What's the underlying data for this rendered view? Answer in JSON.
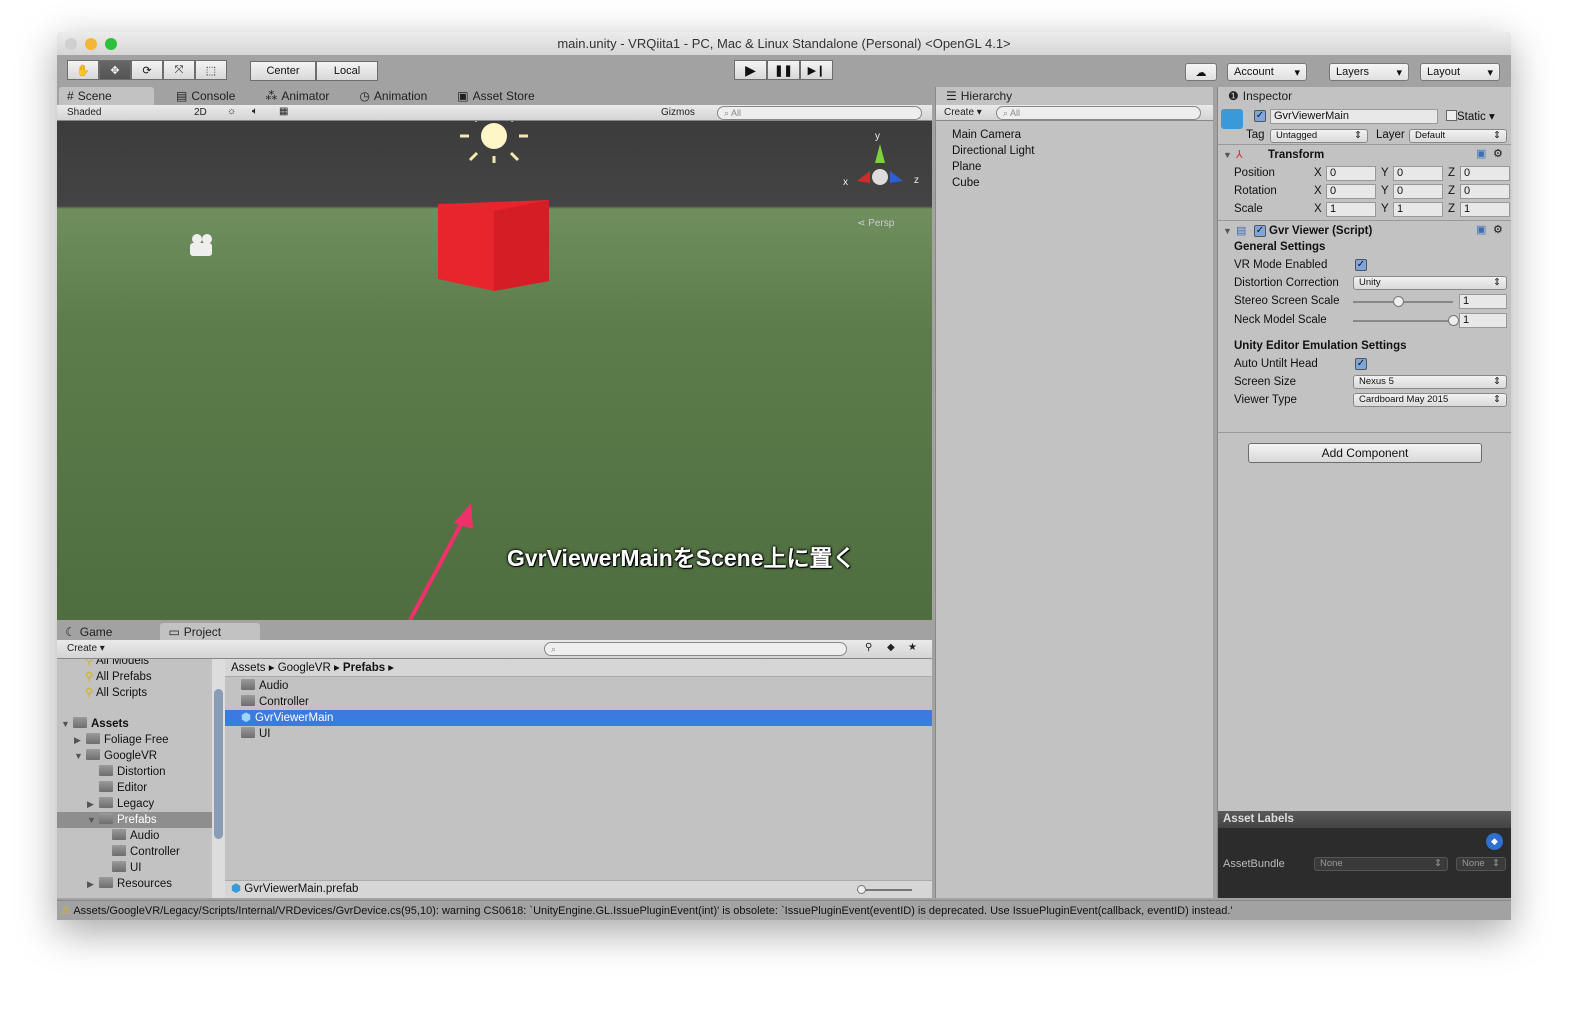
{
  "window": {
    "title": "main.unity - VRQiita1 - PC, Mac & Linux Standalone (Personal) <OpenGL 4.1>"
  },
  "toolbar": {
    "pivot": "Center",
    "space": "Local",
    "account": "Account",
    "layers": "Layers",
    "layout": "Layout"
  },
  "scene_tabs": [
    "Scene",
    "Console",
    "Animator",
    "Animation",
    "Asset Store"
  ],
  "scene_toolbar": {
    "shading": "Shaded",
    "mode2d": "2D",
    "gizmos": "Gizmos",
    "search_placeholder": "All"
  },
  "scene": {
    "gizmo_y": "y",
    "gizmo_x": "x",
    "gizmo_z": "z",
    "persp": "Persp",
    "annotation": "GvrViewerMainをScene上に置く"
  },
  "hierarchy": {
    "tab": "Hierarchy",
    "create": "Create",
    "search_placeholder": "All",
    "items": [
      "Main Camera",
      "Directional Light",
      "Plane",
      "Cube"
    ]
  },
  "inspector": {
    "tab": "Inspector",
    "object_name": "GvrViewerMain",
    "static_label": "Static",
    "tag_label": "Tag",
    "tag": "Untagged",
    "layer_label": "Layer",
    "layer": "Default",
    "transform": {
      "title": "Transform",
      "rows": [
        {
          "label": "Position",
          "x": "0",
          "y": "0",
          "z": "0"
        },
        {
          "label": "Rotation",
          "x": "0",
          "y": "0",
          "z": "0"
        },
        {
          "label": "Scale",
          "x": "1",
          "y": "1",
          "z": "1"
        }
      ]
    },
    "script": {
      "title": "Gvr Viewer (Script)",
      "general": "General Settings",
      "vr_mode": "VR Mode Enabled",
      "distortion_label": "Distortion Correction",
      "distortion": "Unity",
      "stereo_label": "Stereo Screen Scale",
      "stereo": "1",
      "stereo_fraction": 0.45,
      "neck_label": "Neck Model Scale",
      "neck": "1",
      "neck_fraction": 1.0,
      "emulation": "Unity Editor Emulation Settings",
      "auto_untilt": "Auto Untilt Head",
      "screen_size_label": "Screen Size",
      "screen_size": "Nexus 5",
      "viewer_type_label": "Viewer Type",
      "viewer_type": "Cardboard May 2015"
    },
    "add_component": "Add Component",
    "asset_labels": "Asset Labels",
    "asset_bundle": "AssetBundle",
    "bundle_none": "None",
    "bundle_variant": "None"
  },
  "bottom_tabs": [
    "Game",
    "Project"
  ],
  "project": {
    "create": "Create",
    "favorites": [
      "All Models",
      "All Prefabs",
      "All Scripts"
    ],
    "tree": [
      "Assets",
      "Foliage Free",
      "GoogleVR",
      "Distortion",
      "Editor",
      "Legacy",
      "Prefabs",
      "Audio",
      "Controller",
      "UI",
      "Resources"
    ],
    "breadcrumb": [
      "Assets",
      "GoogleVR",
      "Prefabs"
    ],
    "items": [
      "Audio",
      "Controller",
      "GvrViewerMain",
      "UI"
    ],
    "selected_file": "GvrViewerMain.prefab"
  },
  "status": "Assets/GoogleVR/Legacy/Scripts/Internal/VRDevices/GvrDevice.cs(95,10): warning CS0618: `UnityEngine.GL.IssuePluginEvent(int)' is obsolete: `IssuePluginEvent(eventID) is deprecated. Use IssuePluginEvent(callback, eventID) instead.'"
}
